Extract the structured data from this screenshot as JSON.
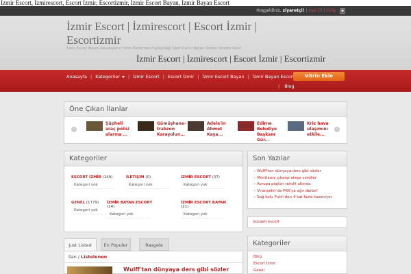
{
  "site_line": "İzmir Escort, İzmirescort, Escort İzmir, Escortizmir, İzmir Escort Bayan, İzmir Bayan Escort",
  "topbar": {
    "greeting": "Hoşgeldiniz,",
    "user": "ziyaretçi!",
    "signup": "Üye Ol",
    "login": "Giriş",
    "rss_icon": "rss-icon"
  },
  "header": {
    "logo_line1": "İzmir Escort | İzmirescort | Escort İzmir |",
    "logo_line2": "Escortizmir",
    "tagline": "İzmir Escort Bayan Arkadaşların Vitrin İlanlarının Paylaşıldığı İzmir Escort Bayan İlanları Tanıtım Sitesi",
    "banner": "İzmir Escort | İzmirescort | Escort İzmir | Escortizmir"
  },
  "nav": {
    "items": [
      "Anasayfa",
      "Kategoriler",
      "İzmir Escort",
      "Escort İzmir",
      "İzmir Escort Bayan",
      "İzmir Bayan Escort"
    ],
    "blog": "Blog",
    "vitrin_button": "Vitrin Ekle"
  },
  "featured": {
    "title": "Öne Çıkan İlanlar",
    "items": [
      {
        "title": "Şüpheli araç polisi alarma ...",
        "thumb_color": "#6b5a3a"
      },
      {
        "title": "Gümüşhane-trabzon Karayolun...",
        "thumb_color": "#3a2a1a"
      },
      {
        "title": "Adele'in Ahmet Kaya...",
        "thumb_color": "#4a3a30"
      },
      {
        "title": "Edirne Belediye Başkanı Gür...",
        "thumb_color": "#8a2a2a"
      },
      {
        "title": "Kriz hava ulaşımını etkile...",
        "thumb_color": "#5a6a80"
      }
    ]
  },
  "categories": {
    "title": "Kategoriler",
    "items": [
      {
        "name": "ESCORT İZMİR",
        "count": "(149)",
        "sub": "Kategori yok"
      },
      {
        "name": "İLETİŞİM",
        "count": "(0)",
        "sub": "Kategori yok"
      },
      {
        "name": "İZMİR ESCORT",
        "count": "(37)",
        "sub": "Kategori yok"
      },
      {
        "name": "GENEL",
        "count": "(1779)",
        "sub": "Kategori yok"
      },
      {
        "name": "İZMİR BAYAN ESCORT",
        "count": "(14)",
        "sub": "Kategori yok"
      },
      {
        "name": "İZMİR ESCORT BAYAN",
        "count": "(21)",
        "sub": "Kategori yok"
      }
    ]
  },
  "tabs": [
    "Just Listed",
    "En Populer",
    "Rasgele"
  ],
  "listing": {
    "crumb_prefix": "İlan /",
    "crumb_current": "Listelenen",
    "first_title": "Wulff'tan dünyaya ders gibi sözler"
  },
  "recent": {
    "title": "Son Yazılar",
    "items": [
      "Wulff'tan dünyaya ders gibi sözler",
      "Montlarını çıkarıp ateşe verdiler",
      "Avrupa piajları tehdit altında",
      "Viranşehir'de PKK'ya ağır darbe!",
      "Sağ kolu Putin'den 4 kat fazla kazanıyor"
    ]
  },
  "side_link": "kocaeli escort",
  "side_categories": {
    "title": "Kategoriler",
    "items": [
      "Blog",
      "Escort İzmir",
      "Genel"
    ]
  }
}
